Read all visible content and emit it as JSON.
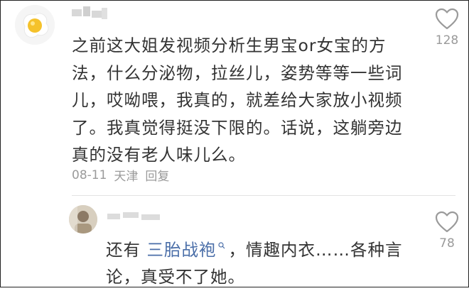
{
  "comment": {
    "text": "之前这大姐发视频分析生男宝or女宝的方法，什么分泌物，拉丝儿，姿势等等一些词儿，哎呦喂，我真的，就差给大家放小视频了。我真觉得挺没下限的。话说，这躺旁边真的没有老人味儿么。",
    "date": "08-11",
    "location": "天津",
    "reply_label": "回复",
    "like_count": "128"
  },
  "reply": {
    "text_before": "还有 ",
    "link_text": "三胎战袍",
    "text_after": "，情趣内衣……各种言论，真受不了她。",
    "like_count": "78"
  },
  "colors": {
    "link": "#4a6ea8",
    "meta_gray": "#9a9a9a",
    "text": "#333333"
  },
  "icons": {
    "like": "heart-outline-icon",
    "link_marker": "search-icon"
  }
}
